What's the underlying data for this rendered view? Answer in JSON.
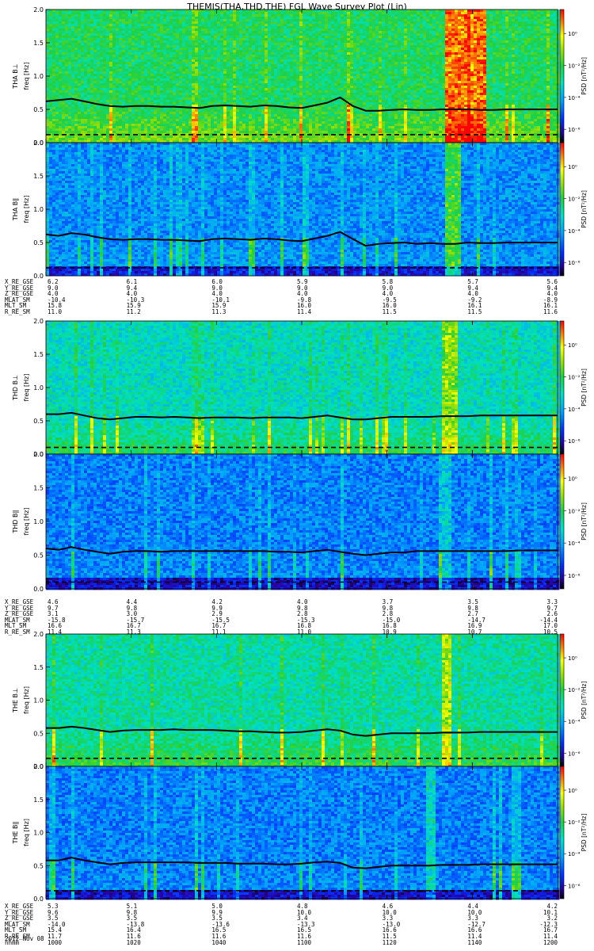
{
  "title": "THEMIS(THA,THD,THE) FGL Wave Survey Plot (Lin)",
  "footer": {
    "date": "2012 Nov 08"
  },
  "chart_data": [
    {
      "type": "heatmap",
      "probe": "THA",
      "panels": [
        {
          "ylabel": "THA B⊥",
          "ylabel2": "freq [Hz]",
          "ylim": [
            0,
            2.0
          ],
          "yticks": [
            "0.0",
            "0.5",
            "1.0",
            "1.5",
            "2.0"
          ],
          "cbar_label": "PSD [nT²/Hz]",
          "cbar_ticks": [
            "10⁰",
            "10⁻²",
            "10⁻⁴",
            "10⁻⁶"
          ],
          "intensity": 0.55,
          "burst_x": [
            0.78,
            0.86
          ],
          "burst_strength": 1.0,
          "line_freq": [
            0.62,
            0.64,
            0.66,
            0.62,
            0.58,
            0.55,
            0.54,
            0.55,
            0.55,
            0.54,
            0.54,
            0.53,
            0.52,
            0.55,
            0.56,
            0.55,
            0.54,
            0.56,
            0.55,
            0.53,
            0.52,
            0.56,
            0.6,
            0.68,
            0.55,
            0.48,
            0.48,
            0.49,
            0.5,
            0.49,
            0.49,
            0.5,
            0.5,
            0.5,
            0.49,
            0.49,
            0.5,
            0.5,
            0.5,
            0.5,
            0.5
          ],
          "dash_freq": 0.12
        },
        {
          "ylabel": "THA B∥",
          "ylabel2": "freq [Hz]",
          "ylim": [
            0,
            2.0
          ],
          "yticks": [
            "0.0",
            "0.5",
            "1.0",
            "1.5",
            "2.0"
          ],
          "cbar_label": "PSD [nT²/Hz]",
          "cbar_ticks": [
            "10⁰",
            "10⁻²",
            "10⁻⁴",
            "10⁻⁶"
          ],
          "intensity": 0.3,
          "burst_x": [
            0.78,
            0.81
          ],
          "burst_strength": 0.8,
          "line_freq": [
            0.62,
            0.6,
            0.64,
            0.62,
            0.58,
            0.55,
            0.54,
            0.55,
            0.55,
            0.54,
            0.54,
            0.53,
            0.52,
            0.55,
            0.56,
            0.55,
            0.54,
            0.56,
            0.55,
            0.53,
            0.52,
            0.56,
            0.6,
            0.66,
            0.55,
            0.45,
            0.48,
            0.49,
            0.5,
            0.48,
            0.49,
            0.48,
            0.48,
            0.5,
            0.49,
            0.49,
            0.5,
            0.5,
            0.5,
            0.5,
            0.5
          ],
          "dash_freq": 0.12
        }
      ],
      "ephemeris": {
        "rows": [
          "X_RE_GSE",
          "Y_RE_GSE",
          "Z_RE_GSE",
          "MLAT_SM",
          "MLT_SM",
          "R_RE_SM"
        ],
        "columns": [
          [
            "6.2",
            "9.0",
            "4.0",
            "-10.4",
            "15.8",
            "11.0"
          ],
          [
            "6.1",
            "9.4",
            "4.0",
            "-10.3",
            "15.9",
            "11.2"
          ],
          [
            "6.0",
            "9.0",
            "4.0",
            "-10.1",
            "15.9",
            "11.3"
          ],
          [
            "5.9",
            "9.0",
            "4.0",
            "-9.8",
            "16.0",
            "11.4"
          ],
          [
            "5.8",
            "9.0",
            "4.0",
            "-9.5",
            "16.0",
            "11.5"
          ],
          [
            "5.7",
            "9.4",
            "4.0",
            "-9.2",
            "16.1",
            "11.5"
          ],
          [
            "5.6",
            "9.4",
            "4.0",
            "-8.9",
            "16.1",
            "11.6"
          ]
        ]
      }
    },
    {
      "type": "heatmap",
      "probe": "THD",
      "panels": [
        {
          "ylabel": "THD B⊥",
          "ylabel2": "freq [Hz]",
          "ylim": [
            0,
            2.0
          ],
          "yticks": [
            "0.0",
            "0.5",
            "1.0",
            "1.5",
            "2.0"
          ],
          "cbar_label": "PSD [nT²/Hz]",
          "cbar_ticks": [
            "10⁰",
            "10⁻²",
            "10⁻⁴",
            "10⁻⁶"
          ],
          "intensity": 0.45,
          "burst_x": [
            0.77,
            0.8
          ],
          "burst_strength": 0.55,
          "line_freq": [
            0.6,
            0.6,
            0.62,
            0.58,
            0.54,
            0.52,
            0.54,
            0.56,
            0.56,
            0.55,
            0.56,
            0.55,
            0.54,
            0.55,
            0.55,
            0.55,
            0.54,
            0.55,
            0.55,
            0.55,
            0.54,
            0.56,
            0.58,
            0.55,
            0.52,
            0.52,
            0.54,
            0.56,
            0.56,
            0.56,
            0.56,
            0.57,
            0.57,
            0.57,
            0.58,
            0.58,
            0.58,
            0.58,
            0.58,
            0.58,
            0.58
          ],
          "dash_freq": 0.1
        },
        {
          "ylabel": "THD B∥",
          "ylabel2": "freq [Hz]",
          "ylim": [
            0,
            2.0
          ],
          "yticks": [
            "0.0",
            "0.5",
            "1.0",
            "1.5",
            "2.0"
          ],
          "cbar_label": "PSD [nT²/Hz]",
          "cbar_ticks": [
            "10⁰",
            "10⁻²",
            "10⁻⁴",
            "10⁻⁶"
          ],
          "intensity": 0.28,
          "burst_x": [
            0.77,
            0.79
          ],
          "burst_strength": 0.2,
          "line_freq": [
            0.6,
            0.58,
            0.62,
            0.58,
            0.55,
            0.52,
            0.55,
            0.56,
            0.56,
            0.55,
            0.56,
            0.56,
            0.56,
            0.56,
            0.56,
            0.56,
            0.56,
            0.56,
            0.55,
            0.55,
            0.54,
            0.56,
            0.58,
            0.55,
            0.52,
            0.5,
            0.52,
            0.54,
            0.54,
            0.56,
            0.56,
            0.56,
            0.56,
            0.56,
            0.56,
            0.56,
            0.56,
            0.57,
            0.57,
            0.57,
            0.57
          ],
          "dash_freq": 0.1
        }
      ],
      "ephemeris": {
        "rows": [
          "X_RE_GSE",
          "Y_RE_GSE",
          "Z_RE_GSE",
          "MLAT_SM",
          "MLT_SM",
          "R_RE_SM"
        ],
        "columns": [
          [
            "4.6",
            "9.7",
            "3.1",
            "-15.8",
            "16.6",
            "11.4"
          ],
          [
            "4.4",
            "9.8",
            "3.0",
            "-15.7",
            "16.7",
            "11.3"
          ],
          [
            "4.2",
            "9.9",
            "2.9",
            "-15.5",
            "16.7",
            "11.1"
          ],
          [
            "4.0",
            "9.8",
            "2.8",
            "-15.3",
            "16.8",
            "11.0"
          ],
          [
            "3.7",
            "9.8",
            "2.8",
            "-15.0",
            "16.8",
            "10.9"
          ],
          [
            "3.5",
            "9.8",
            "2.7",
            "-14.7",
            "16.9",
            "10.7"
          ],
          [
            "3.3",
            "9.7",
            "2.6",
            "-14.4",
            "17.0",
            "10.5"
          ]
        ]
      }
    },
    {
      "type": "heatmap",
      "probe": "THE",
      "panels": [
        {
          "ylabel": "THE B⊥",
          "ylabel2": "freq [Hz]",
          "ylim": [
            0,
            2.0
          ],
          "yticks": [
            "0.0",
            "0.5",
            "1.0",
            "1.5",
            "2.0"
          ],
          "cbar_label": "PSD [nT²/Hz]",
          "cbar_ticks": [
            "10⁰",
            "10⁻²",
            "10⁻⁴",
            "10⁻⁶"
          ],
          "intensity": 0.48,
          "burst_x": [
            0.77,
            0.79
          ],
          "burst_strength": 0.6,
          "line_freq": [
            0.58,
            0.58,
            0.6,
            0.58,
            0.55,
            0.52,
            0.54,
            0.55,
            0.55,
            0.55,
            0.56,
            0.55,
            0.55,
            0.55,
            0.54,
            0.53,
            0.53,
            0.52,
            0.51,
            0.51,
            0.52,
            0.54,
            0.56,
            0.54,
            0.48,
            0.46,
            0.48,
            0.5,
            0.5,
            0.5,
            0.5,
            0.51,
            0.51,
            0.51,
            0.52,
            0.52,
            0.52,
            0.52,
            0.52,
            0.52,
            0.52
          ],
          "dash_freq": 0.12
        },
        {
          "ylabel": "THE B∥",
          "ylabel2": "freq [Hz]",
          "ylim": [
            0,
            2.0
          ],
          "yticks": [
            "0.0",
            "0.5",
            "1.0",
            "1.5",
            "2.0"
          ],
          "cbar_label": "PSD [nT²/Hz]",
          "cbar_ticks": [
            "10⁰",
            "10⁻²",
            "10⁻⁴",
            "10⁻⁶"
          ],
          "intensity": 0.28,
          "burst_x": [
            0.74,
            0.76
          ],
          "burst_strength": 0.35,
          "line_freq": [
            0.58,
            0.58,
            0.62,
            0.58,
            0.55,
            0.52,
            0.54,
            0.55,
            0.55,
            0.55,
            0.55,
            0.55,
            0.54,
            0.54,
            0.54,
            0.53,
            0.53,
            0.53,
            0.52,
            0.52,
            0.53,
            0.55,
            0.56,
            0.54,
            0.47,
            0.46,
            0.48,
            0.5,
            0.5,
            0.5,
            0.5,
            0.51,
            0.51,
            0.51,
            0.52,
            0.52,
            0.52,
            0.52,
            0.52,
            0.52,
            0.52
          ],
          "dash_freq": 0.12
        }
      ],
      "ephemeris": {
        "rows": [
          "X_RE_GSE",
          "Y_RE_GSE",
          "Z_RE_GSE",
          "MLAT_SM",
          "MLT_SM",
          "R_RE_SM",
          "hhmm"
        ],
        "columns": [
          [
            "5.3",
            "9.6",
            "3.5",
            "-14.0",
            "15.4",
            "11.7",
            "1000"
          ],
          [
            "5.1",
            "9.8",
            "3.5",
            "-13.8",
            "16.4",
            "11.6",
            "1020"
          ],
          [
            "5.0",
            "9.9",
            "3.5",
            "-13.6",
            "16.5",
            "11.6",
            "1040"
          ],
          [
            "4.8",
            "10.0",
            "3.4",
            "-13.3",
            "16.5",
            "11.6",
            "1100"
          ],
          [
            "4.6",
            "10.0",
            "3.3",
            "-13.0",
            "16.6",
            "11.5",
            "1120"
          ],
          [
            "4.4",
            "10.0",
            "3.3",
            "-12.7",
            "16.6",
            "11.4",
            "1140"
          ],
          [
            "4.2",
            "10.1",
            "3.2",
            "-12.3",
            "16.7",
            "11.4",
            "1200"
          ]
        ]
      }
    }
  ]
}
